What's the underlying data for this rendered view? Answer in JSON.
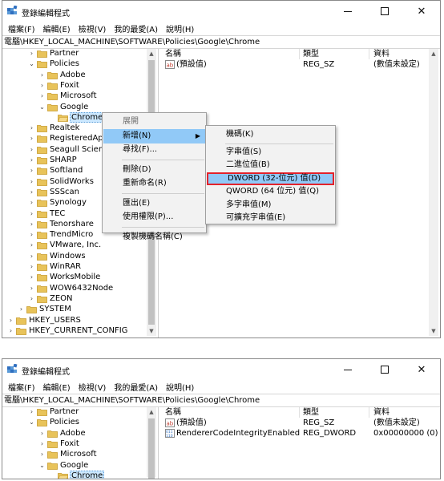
{
  "window": {
    "title": "登錄編輯程式",
    "menu": [
      "檔案(F)",
      "編輯(E)",
      "檢視(V)",
      "我的最愛(A)",
      "說明(H)"
    ],
    "address": "電腦\\HKEY_LOCAL_MACHINE\\SOFTWARE\\Policies\\Google\\Chrome"
  },
  "tree1": [
    {
      "label": "Partner",
      "depth": 2,
      "expander": "collapsed"
    },
    {
      "label": "Policies",
      "depth": 2,
      "expander": "expanded"
    },
    {
      "label": "Adobe",
      "depth": 3,
      "expander": "collapsed"
    },
    {
      "label": "Foxit",
      "depth": 3,
      "expander": "collapsed"
    },
    {
      "label": "Microsoft",
      "depth": 3,
      "expander": "collapsed"
    },
    {
      "label": "Google",
      "depth": 3,
      "expander": "expanded"
    },
    {
      "label": "Chrome",
      "depth": 4,
      "expander": "none",
      "selected": true
    },
    {
      "label": "Realtek",
      "depth": 2,
      "expander": "collapsed"
    },
    {
      "label": "RegisteredAp",
      "depth": 2,
      "expander": "collapsed"
    },
    {
      "label": "Seagull Scien",
      "depth": 2,
      "expander": "collapsed"
    },
    {
      "label": "SHARP",
      "depth": 2,
      "expander": "collapsed"
    },
    {
      "label": "Softland",
      "depth": 2,
      "expander": "collapsed"
    },
    {
      "label": "SolidWorks",
      "depth": 2,
      "expander": "collapsed"
    },
    {
      "label": "SSScan",
      "depth": 2,
      "expander": "collapsed"
    },
    {
      "label": "Synology",
      "depth": 2,
      "expander": "collapsed"
    },
    {
      "label": "TEC",
      "depth": 2,
      "expander": "collapsed"
    },
    {
      "label": "Tenorshare",
      "depth": 2,
      "expander": "collapsed"
    },
    {
      "label": "TrendMicro",
      "depth": 2,
      "expander": "collapsed"
    },
    {
      "label": "VMware, Inc.",
      "depth": 2,
      "expander": "collapsed"
    },
    {
      "label": "Windows",
      "depth": 2,
      "expander": "collapsed"
    },
    {
      "label": "WinRAR",
      "depth": 2,
      "expander": "collapsed"
    },
    {
      "label": "WorksMobile",
      "depth": 2,
      "expander": "collapsed"
    },
    {
      "label": "WOW6432Node",
      "depth": 2,
      "expander": "collapsed"
    },
    {
      "label": "ZEON",
      "depth": 2,
      "expander": "collapsed"
    },
    {
      "label": "SYSTEM",
      "depth": 1,
      "expander": "collapsed"
    },
    {
      "label": "HKEY_USERS",
      "depth": 0,
      "expander": "collapsed"
    },
    {
      "label": "HKEY_CURRENT_CONFIG",
      "depth": 0,
      "expander": "collapsed"
    }
  ],
  "tree2": [
    {
      "label": "Partner",
      "depth": 2,
      "expander": "collapsed"
    },
    {
      "label": "Policies",
      "depth": 2,
      "expander": "expanded"
    },
    {
      "label": "Adobe",
      "depth": 3,
      "expander": "collapsed"
    },
    {
      "label": "Foxit",
      "depth": 3,
      "expander": "collapsed"
    },
    {
      "label": "Microsoft",
      "depth": 3,
      "expander": "collapsed"
    },
    {
      "label": "Google",
      "depth": 3,
      "expander": "expanded"
    },
    {
      "label": "Chrome",
      "depth": 4,
      "expander": "none",
      "selected": true
    }
  ],
  "columns": {
    "name": "名稱",
    "type": "類型",
    "data": "資料"
  },
  "values1": [
    {
      "name": "(預設值)",
      "type": "REG_SZ",
      "data": "(數值未設定)",
      "icon": "string-value-icon"
    }
  ],
  "values2": [
    {
      "name": "(預設值)",
      "type": "REG_SZ",
      "data": "(數值未設定)",
      "icon": "string-value-icon"
    },
    {
      "name": "RendererCodeIntegrityEnabled",
      "type": "REG_DWORD",
      "data": "0x00000000 (0)",
      "icon": "binary-value-icon"
    }
  ],
  "context_menu": {
    "items": [
      {
        "label": "展開",
        "state": "disabled"
      },
      {
        "label": "新增(N)",
        "state": "highlighted",
        "submenu": true
      },
      {
        "label": "尋找(F)...",
        "state": "normal"
      },
      {
        "sep": true
      },
      {
        "label": "刪除(D)",
        "state": "normal"
      },
      {
        "label": "重新命名(R)",
        "state": "normal"
      },
      {
        "sep": true
      },
      {
        "label": "匯出(E)",
        "state": "normal"
      },
      {
        "label": "使用權限(P)...",
        "state": "normal"
      },
      {
        "sep": true
      },
      {
        "label": "複製機碼名稱(C)",
        "state": "normal"
      }
    ]
  },
  "submenu": {
    "items": [
      {
        "label": "機碼(K)",
        "state": "normal"
      },
      {
        "sep": true
      },
      {
        "label": "字串值(S)",
        "state": "normal"
      },
      {
        "label": "二進位值(B)",
        "state": "normal"
      },
      {
        "label": "DWORD (32-位元) 值(D)",
        "state": "highlighted"
      },
      {
        "label": "QWORD (64 位元) 值(Q)",
        "state": "normal"
      },
      {
        "label": "多字串值(M)",
        "state": "normal"
      },
      {
        "label": "可擴充字串值(E)",
        "state": "normal"
      }
    ]
  },
  "colors": {
    "selection": "#cce8ff",
    "menu_highlight": "#91c9f7",
    "callout_border": "#e3222b",
    "folder": "#e8c35a"
  }
}
